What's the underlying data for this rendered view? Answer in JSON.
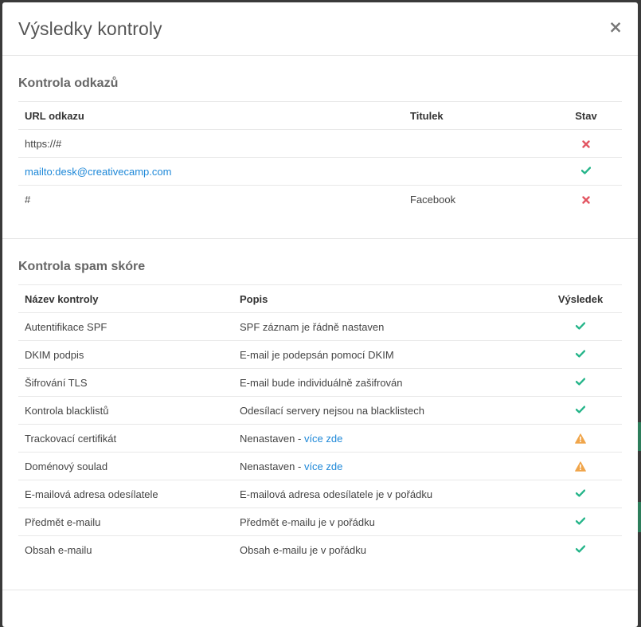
{
  "modal": {
    "title": "Výsledky kontroly",
    "close_label": "×"
  },
  "links_section": {
    "title": "Kontrola odkazů",
    "headers": [
      "URL odkazu",
      "Titulek",
      "Stav"
    ],
    "rows": [
      {
        "url": "https://#",
        "title": "",
        "status": "error",
        "is_link": false
      },
      {
        "url": "mailto:desk@creativecamp.com",
        "title": "",
        "status": "ok",
        "is_link": true
      },
      {
        "url": "#",
        "title": "Facebook",
        "status": "error",
        "is_link": false
      }
    ]
  },
  "spam_section": {
    "title": "Kontrola spam skóre",
    "headers": [
      "Název kontroly",
      "Popis",
      "Výsledek"
    ],
    "rows": [
      {
        "name": "Autentifikace SPF",
        "desc": "SPF záznam je řádně nastaven",
        "link": "",
        "status": "ok"
      },
      {
        "name": "DKIM podpis",
        "desc": "E-mail je podepsán pomocí DKIM",
        "link": "",
        "status": "ok"
      },
      {
        "name": "Šifrování TLS",
        "desc": "E-mail bude individuálně zašifrován",
        "link": "",
        "status": "ok"
      },
      {
        "name": "Kontrola blacklistů",
        "desc": "Odesílací servery nejsou na blacklistech",
        "link": "",
        "status": "ok"
      },
      {
        "name": "Trackovací certifikát",
        "desc": "Nenastaven - ",
        "link": "více zde",
        "status": "warning"
      },
      {
        "name": "Doménový soulad",
        "desc": "Nenastaven - ",
        "link": "více zde",
        "status": "warning"
      },
      {
        "name": "E-mailová adresa odesílatele",
        "desc": "E-mailová adresa odesílatele je v pořádku",
        "link": "",
        "status": "ok"
      },
      {
        "name": "Předmět e-mailu",
        "desc": "Předmět e-mailu je v pořádku",
        "link": "",
        "status": "ok"
      },
      {
        "name": "Obsah e-mailu",
        "desc": "Obsah e-mailu je v pořádku",
        "link": "",
        "status": "ok"
      }
    ]
  },
  "colors": {
    "ok": "#26b58a",
    "error": "#e25561",
    "warning": "#f0a54a",
    "link": "#1e88d8"
  }
}
